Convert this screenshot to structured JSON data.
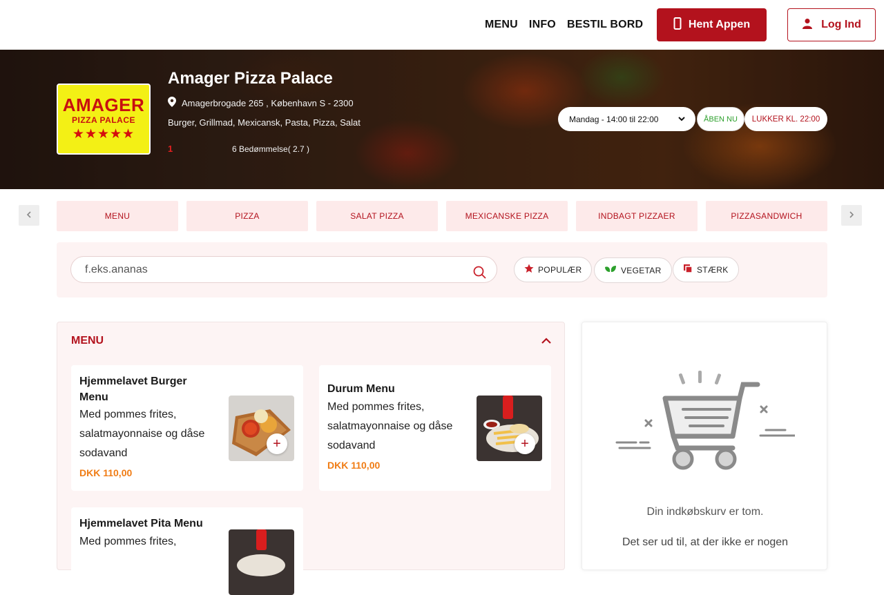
{
  "nav": {
    "links": [
      "MENU",
      "INFO",
      "BESTIL BORD"
    ],
    "app_button": "Hent Appen",
    "login_button": "Log Ind"
  },
  "restaurant": {
    "logo_line1": "AMAGER",
    "logo_line2": "PIZZA PALACE",
    "logo_stars": "★★★★★",
    "name": "Amager Pizza Palace",
    "address": "Amagerbrogade 265 , København S - 2300",
    "categories": "Burger, Grillmad, Mexicansk, Pasta, Pizza, Salat",
    "rating_marker": "1",
    "rating_text": "6  Bedømmelse( 2.7 )",
    "rating_value": 2.7,
    "hours": "Mandag - 14:00 til 22:00",
    "open_badge": "ÅBEN NU",
    "closes_badge": "LUKKER KL. 22:00"
  },
  "category_tabs": [
    "MENU",
    "PIZZA",
    "SALAT PIZZA",
    "MEXICANSKE PIZZA",
    "INDBAGT PIZZAER",
    "PIZZASANDWICH"
  ],
  "search": {
    "placeholder": "f.eks.ananas"
  },
  "filters": [
    "POPULÆR",
    "VEGETAR",
    "STÆRK"
  ],
  "menu_section": {
    "title": "MENU",
    "items": [
      {
        "name": "Hjemmelavet Burger Menu",
        "desc": "Med pommes frites, salatmayonnaise og dåse sodavand",
        "price": "DKK 110,00"
      },
      {
        "name": "Durum Menu",
        "desc": "Med pommes frites, salatmayonnaise og dåse sodavand",
        "price": "DKK 110,00"
      },
      {
        "name": "Hjemmelavet Pita Menu",
        "desc": "Med pommes frites,",
        "price": ""
      }
    ]
  },
  "cart": {
    "empty_title": "Din indkøbskurv er tom.",
    "empty_message": "Det ser ud til, at der ikke er nogen"
  },
  "colors": {
    "brand_red": "#b3121d",
    "price_orange": "#f07c14",
    "open_green": "#2ca02c"
  }
}
